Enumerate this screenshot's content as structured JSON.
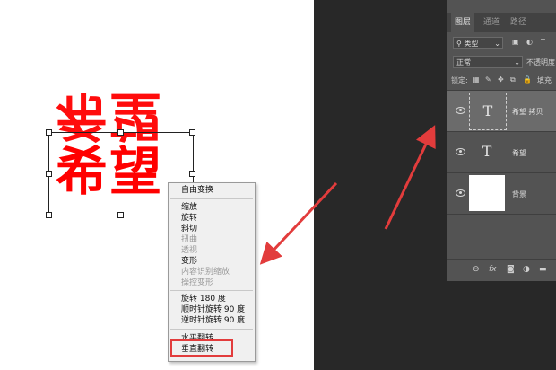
{
  "canvas": {
    "text_top_flipped": "希望",
    "text_bottom": "希望"
  },
  "context_menu": {
    "items": [
      {
        "label": "自由变换",
        "disabled": false
      },
      {
        "label": "缩放",
        "disabled": false
      },
      {
        "label": "旋转",
        "disabled": false
      },
      {
        "label": "斜切",
        "disabled": false
      },
      {
        "label": "扭曲",
        "disabled": true
      },
      {
        "label": "透视",
        "disabled": true
      },
      {
        "label": "变形",
        "disabled": false
      },
      {
        "label": "内容识别缩放",
        "disabled": true
      },
      {
        "label": "操控变形",
        "disabled": true
      },
      {
        "label": "旋转 180 度",
        "disabled": false
      },
      {
        "label": "顺时针旋转 90 度",
        "disabled": false
      },
      {
        "label": "逆时针旋转 90 度",
        "disabled": false
      },
      {
        "label": "水平翻转",
        "disabled": false
      },
      {
        "label": "垂直翻转",
        "disabled": false
      }
    ]
  },
  "layers_panel": {
    "tabs": [
      "图层",
      "通道",
      "路径"
    ],
    "filter_label": "类型",
    "blend_mode": "正常",
    "opacity_label": "不透明度",
    "lock_label": "锁定:",
    "fill_label": "填充",
    "layers": [
      {
        "name": "希望 拷贝",
        "type": "text",
        "thumb": "T"
      },
      {
        "name": "希望",
        "type": "text",
        "thumb": "T"
      },
      {
        "name": "背景",
        "type": "background",
        "thumb": ""
      }
    ],
    "bottom_icons": [
      "link-icon",
      "fx-icon",
      "mask-icon",
      "adjustment-icon",
      "folder-icon"
    ],
    "fx_label": "fx"
  },
  "colors": {
    "text_red": "#ff0000",
    "highlight_red": "#e23c3c",
    "selected_layer": "#6b6b6b"
  }
}
